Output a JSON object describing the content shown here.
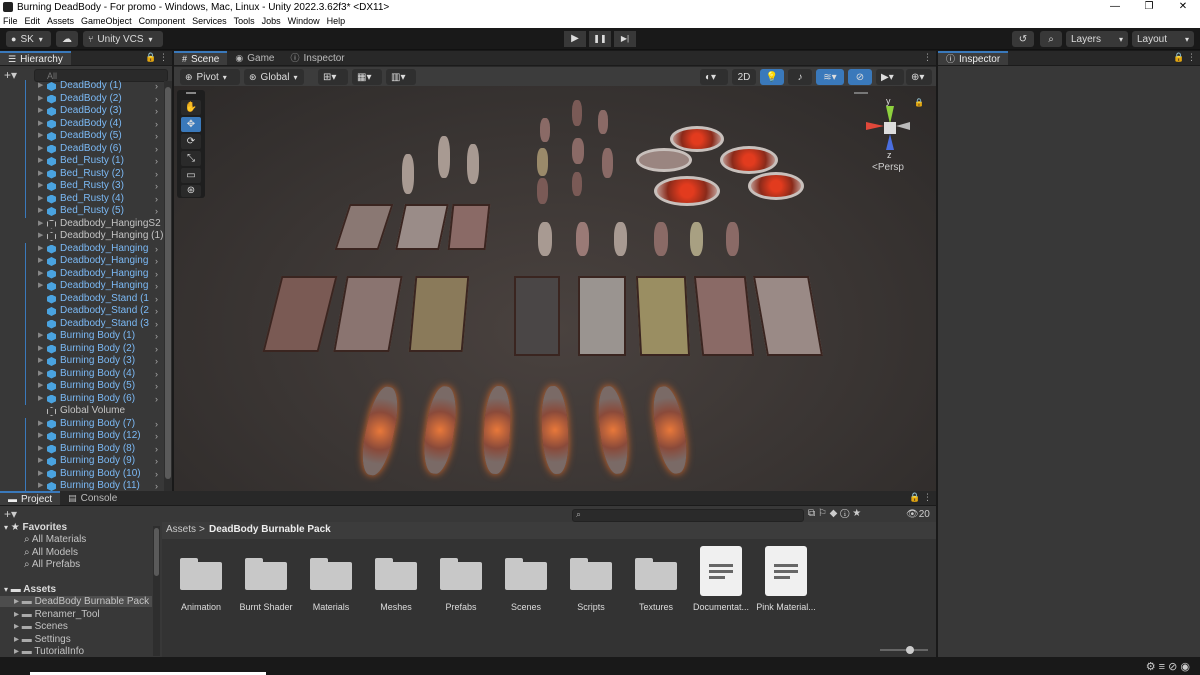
{
  "window": {
    "title": "Burning DeadBody - For promo - Windows, Mac, Linux - Unity 2022.3.62f3* <DX11>",
    "min": "—",
    "max": "❐",
    "close": "✕"
  },
  "menu": [
    "File",
    "Edit",
    "Assets",
    "GameObject",
    "Component",
    "Services",
    "Tools",
    "Jobs",
    "Window",
    "Help"
  ],
  "toolbar": {
    "account": "SK",
    "vcs": "Unity VCS",
    "layers": "Layers",
    "layout": "Layout",
    "play": "▶",
    "pause": "❚❚",
    "step": "▶|"
  },
  "hierarchy": {
    "tab": "Hierarchy",
    "search_placeholder": "All",
    "items": [
      {
        "label": "DeadBody (1)",
        "prefab": true,
        "expand": true,
        "chev": true
      },
      {
        "label": "DeadBody (2)",
        "prefab": true,
        "expand": true,
        "chev": true
      },
      {
        "label": "DeadBody (3)",
        "prefab": true,
        "expand": true,
        "chev": true
      },
      {
        "label": "DeadBody (4)",
        "prefab": true,
        "expand": true,
        "chev": true
      },
      {
        "label": "DeadBody (5)",
        "prefab": true,
        "expand": true,
        "chev": true
      },
      {
        "label": "DeadBody (6)",
        "prefab": true,
        "expand": true,
        "chev": true
      },
      {
        "label": "Bed_Rusty (1)",
        "prefab": true,
        "expand": true,
        "chev": true
      },
      {
        "label": "Bed_Rusty (2)",
        "prefab": true,
        "expand": true,
        "chev": true
      },
      {
        "label": "Bed_Rusty (3)",
        "prefab": true,
        "expand": true,
        "chev": true
      },
      {
        "label": "Bed_Rusty (4)",
        "prefab": true,
        "expand": true,
        "chev": true
      },
      {
        "label": "Bed_Rusty (5)",
        "prefab": true,
        "expand": true,
        "chev": true
      },
      {
        "label": "Deadbody_HangingS2",
        "prefab": false,
        "expand": true,
        "chev": false
      },
      {
        "label": "Deadbody_Hanging (1)",
        "prefab": false,
        "expand": true,
        "chev": false
      },
      {
        "label": "Deadbody_Hanging",
        "prefab": true,
        "expand": true,
        "chev": true
      },
      {
        "label": "Deadbody_Hanging",
        "prefab": true,
        "expand": true,
        "chev": true
      },
      {
        "label": "Deadbody_Hanging",
        "prefab": true,
        "expand": true,
        "chev": true
      },
      {
        "label": "Deadbody_Hanging",
        "prefab": true,
        "expand": true,
        "chev": true
      },
      {
        "label": "Deadbody_Stand (1",
        "prefab": true,
        "expand": false,
        "chev": true
      },
      {
        "label": "Deadbody_Stand (2",
        "prefab": true,
        "expand": false,
        "chev": true
      },
      {
        "label": "Deadbody_Stand (3",
        "prefab": true,
        "expand": false,
        "chev": true
      },
      {
        "label": "Burning Body (1)",
        "prefab": true,
        "expand": true,
        "chev": true
      },
      {
        "label": "Burning Body (2)",
        "prefab": true,
        "expand": true,
        "chev": true
      },
      {
        "label": "Burning Body (3)",
        "prefab": true,
        "expand": true,
        "chev": true
      },
      {
        "label": "Burning Body (4)",
        "prefab": true,
        "expand": true,
        "chev": true
      },
      {
        "label": "Burning Body (5)",
        "prefab": true,
        "expand": true,
        "chev": true
      },
      {
        "label": "Burning Body (6)",
        "prefab": true,
        "expand": true,
        "chev": true
      },
      {
        "label": "Global Volume",
        "prefab": false,
        "expand": false,
        "chev": false
      },
      {
        "label": "Burning Body (7)",
        "prefab": true,
        "expand": true,
        "chev": true
      },
      {
        "label": "Burning Body (12)",
        "prefab": true,
        "expand": true,
        "chev": true
      },
      {
        "label": "Burning Body (8)",
        "prefab": true,
        "expand": true,
        "chev": true
      },
      {
        "label": "Burning Body (9)",
        "prefab": true,
        "expand": true,
        "chev": true
      },
      {
        "label": "Burning Body (10)",
        "prefab": true,
        "expand": true,
        "chev": true
      },
      {
        "label": "Burning Body (11)",
        "prefab": true,
        "expand": true,
        "chev": true
      }
    ]
  },
  "scene": {
    "tabs": [
      "Scene",
      "Game",
      "Inspector"
    ],
    "pivot": "Pivot",
    "global": "Global",
    "mode_2d": "2D",
    "persp": "Persp",
    "gizmo": {
      "y": "y",
      "z": "z"
    }
  },
  "inspector": {
    "tab": "Inspector"
  },
  "project": {
    "tabs": [
      "Project",
      "Console"
    ],
    "favorites_label": "Favorites",
    "favorites": [
      "All Materials",
      "All Models",
      "All Prefabs"
    ],
    "assets_label": "Assets",
    "asset_tree": [
      "DeadBody Burnable Pack",
      "Renamer_Tool",
      "Scenes",
      "Settings",
      "TutorialInfo"
    ],
    "breadcrumb_root": "Assets",
    "breadcrumb_current": "DeadBody Burnable Pack",
    "hidden_count": "20",
    "items": [
      {
        "label": "Animation",
        "kind": "folder"
      },
      {
        "label": "Burnt Shader",
        "kind": "folder"
      },
      {
        "label": "Materials",
        "kind": "folder"
      },
      {
        "label": "Meshes",
        "kind": "folder"
      },
      {
        "label": "Prefabs",
        "kind": "folder"
      },
      {
        "label": "Scenes",
        "kind": "folder"
      },
      {
        "label": "Scripts",
        "kind": "folder"
      },
      {
        "label": "Textures",
        "kind": "folder"
      },
      {
        "label": "Documentat...",
        "kind": "doc"
      },
      {
        "label": "Pink Material...",
        "kind": "doc"
      }
    ]
  },
  "colors": {
    "accent": "#3a79bb",
    "prefab_text": "#7bb9f5",
    "panel": "#383838",
    "dark": "#191919"
  }
}
